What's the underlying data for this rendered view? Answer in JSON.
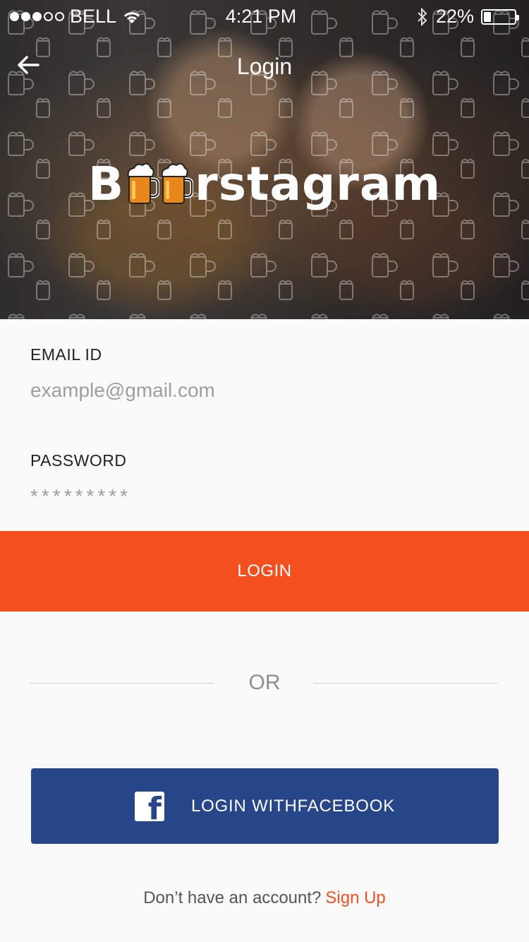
{
  "status_bar": {
    "carrier": "BELL",
    "time": "4:21 PM",
    "battery_text": "22%",
    "battery_level": 0.22,
    "signal_strength": 3
  },
  "nav": {
    "title": "Login",
    "back_icon": "arrow-left-icon"
  },
  "logo": {
    "text_start": "B",
    "text_end": "rstagram"
  },
  "form": {
    "email_label": "EMAIL ID",
    "email_placeholder": "example@gmail.com",
    "password_label": "PASSWORD",
    "password_value": "*********"
  },
  "login_button": "LOGIN",
  "divider_text": "OR",
  "facebook_button": "LOGIN WITHFACEBOOK",
  "signup": {
    "prompt": "Don’t have an account?",
    "link": "Sign Up"
  },
  "colors": {
    "accent": "#f44f1e",
    "facebook": "#27468a",
    "background": "#fafafa"
  }
}
